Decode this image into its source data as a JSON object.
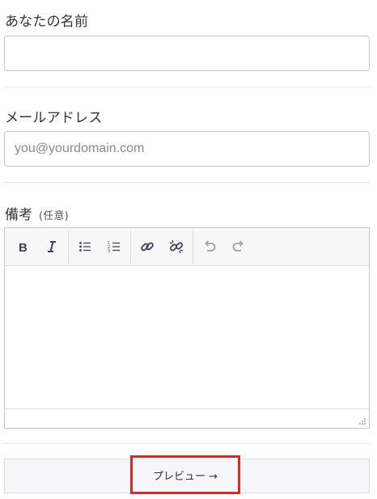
{
  "form": {
    "name_label": "あなたの名前",
    "name_value": "",
    "email_label": "メールアドレス",
    "email_placeholder": "you@yourdomain.com",
    "notes_label": "備考",
    "notes_optional": "(任意)",
    "preview_button": "プレビュー →"
  },
  "editor": {
    "content": "",
    "toolbar": [
      "bold-icon",
      "italic-icon",
      "bullet-list-icon",
      "numbered-list-icon",
      "link-icon",
      "unlink-icon",
      "undo-icon",
      "redo-icon"
    ]
  },
  "colors": {
    "highlight_border": "#d32a2a",
    "footer_background": "#f4f6f8"
  }
}
